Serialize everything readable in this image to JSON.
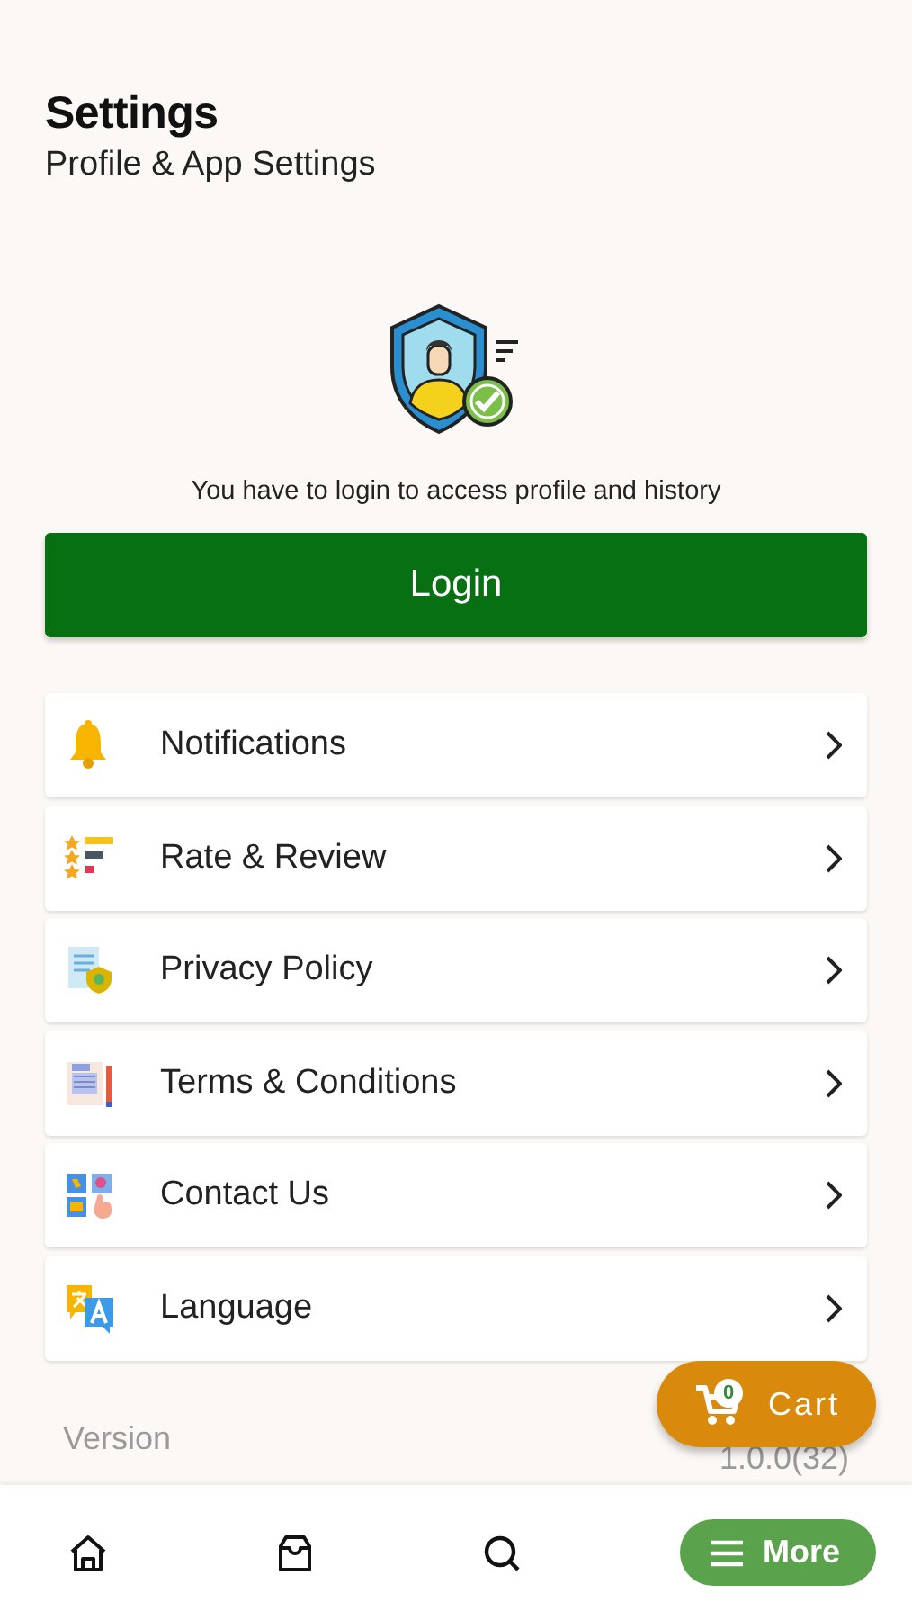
{
  "header": {
    "title": "Settings",
    "subtitle": "Profile & App Settings"
  },
  "login_prompt": "You have to login to access profile and history",
  "login_button": "Login",
  "menu": [
    {
      "kind": "bell",
      "label": "Notifications"
    },
    {
      "kind": "rating",
      "label": "Rate & Review"
    },
    {
      "kind": "privacy",
      "label": "Privacy Policy"
    },
    {
      "kind": "terms",
      "label": "Terms & Conditions"
    },
    {
      "kind": "contact",
      "label": "Contact Us"
    },
    {
      "kind": "language",
      "label": "Language"
    }
  ],
  "version": {
    "label": "Version",
    "value": "1.0.0(32)"
  },
  "cart": {
    "count": "0",
    "label": "Cart"
  },
  "bottom_nav": [
    {
      "kind": "home",
      "selected": false
    },
    {
      "kind": "inbox",
      "selected": false
    },
    {
      "kind": "search",
      "selected": false
    },
    {
      "kind": "menu",
      "label": "More",
      "selected": true
    }
  ]
}
